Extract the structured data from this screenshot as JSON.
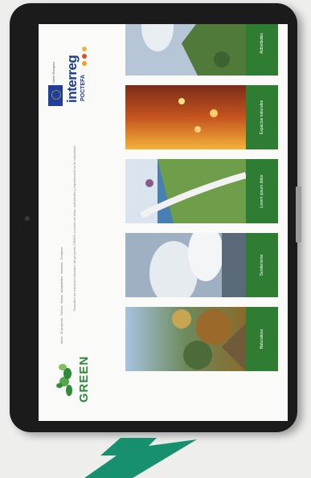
{
  "site": {
    "logo_text": "GREEN",
    "nav": [
      "Inicio",
      "El proyecto",
      "Socios",
      "Rutas",
      "Actividades",
      "Noticias",
      "Contacto"
    ],
    "partners": {
      "eu_text": "Unión Europea",
      "program": "interreg",
      "program_sub": "POCTEFA"
    },
    "intro_text": "Descubre los espacios naturales del proyecto GREEN a través de rutas, actividades y experiencias en la naturaleza.",
    "cards": [
      {
        "label": "Naturaleza"
      },
      {
        "label": "Senderismo"
      },
      {
        "label": "Lorem ipsum dolor"
      },
      {
        "label": "Espacios naturales"
      },
      {
        "label": "Actividades"
      }
    ]
  },
  "colors": {
    "brand_green": "#2e7d32",
    "interreg_blue": "#1e3d8f",
    "eu_blue": "#1f3f9b",
    "arrow_green": "#17906f"
  },
  "icons": [
    "leaf-logo-icon",
    "eu-flag-icon",
    "arrow-icon"
  ]
}
